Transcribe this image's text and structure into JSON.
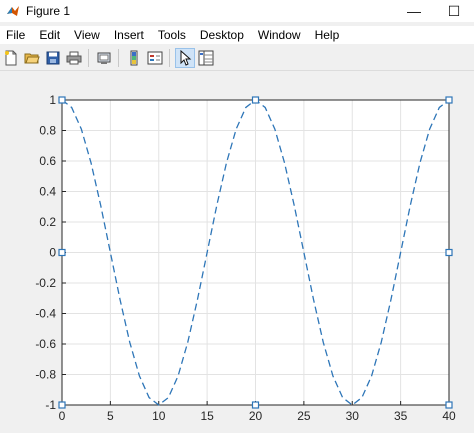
{
  "window": {
    "title": "Figure 1",
    "controls": {
      "minimize": "—",
      "maximize": "☐"
    }
  },
  "menubar": {
    "items": [
      "File",
      "Edit",
      "View",
      "Insert",
      "Tools",
      "Desktop",
      "Window",
      "Help"
    ]
  },
  "toolbar": {
    "buttons": [
      "new-figure-icon",
      "open-file-icon",
      "save-icon",
      "print-icon",
      "link-plot-icon",
      "insert-colorbar-icon",
      "insert-legend-icon",
      "edit-plot-arrow-icon",
      "property-inspector-icon"
    ]
  },
  "colors": {
    "line": "#2e76b8",
    "axes_bg": "#ffffff",
    "grid": "#e3e3e3",
    "figure_bg": "#f0f0f0"
  },
  "chart_data": {
    "type": "line",
    "series": [
      {
        "function": "cos(2*pi*x/20)",
        "style": "dashed",
        "x": [
          0,
          1,
          2,
          3,
          4,
          5,
          6,
          7,
          8,
          9,
          10,
          11,
          12,
          13,
          14,
          15,
          16,
          17,
          18,
          19,
          20,
          21,
          22,
          23,
          24,
          25,
          26,
          27,
          28,
          29,
          30,
          31,
          32,
          33,
          34,
          35,
          36,
          37,
          38,
          39,
          40
        ],
        "y": [
          1,
          0.951,
          0.809,
          0.588,
          0.309,
          0,
          -0.309,
          -0.588,
          -0.809,
          -0.951,
          -1,
          -0.951,
          -0.809,
          -0.588,
          -0.309,
          0,
          0.309,
          0.588,
          0.809,
          0.951,
          1,
          0.951,
          0.809,
          0.588,
          0.309,
          0,
          -0.309,
          -0.588,
          -0.809,
          -0.951,
          -1,
          -0.951,
          -0.809,
          -0.588,
          -0.309,
          0,
          0.309,
          0.588,
          0.809,
          0.951,
          1
        ]
      }
    ],
    "xlim": [
      0,
      40
    ],
    "ylim": [
      -1,
      1
    ],
    "xticks": [
      "0",
      "5",
      "10",
      "15",
      "20",
      "25",
      "30",
      "35",
      "40"
    ],
    "yticks": [
      "-1",
      "-0.8",
      "-0.6",
      "-0.4",
      "-0.2",
      "0",
      "0.2",
      "0.4",
      "0.6",
      "0.8",
      "1"
    ],
    "grid": true,
    "selected": true
  }
}
